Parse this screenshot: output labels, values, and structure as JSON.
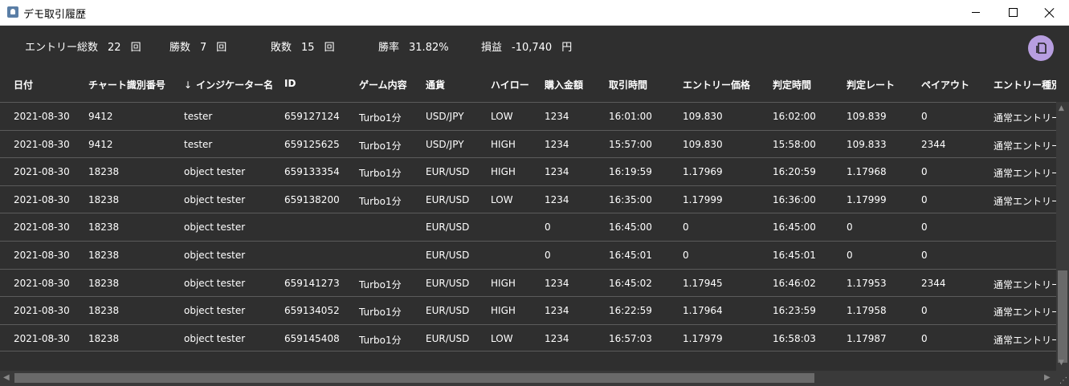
{
  "window": {
    "title": "デモ取引履歴"
  },
  "stats": {
    "entries": {
      "label": "エントリー総数",
      "value": "22",
      "unit": "回"
    },
    "wins": {
      "label": "勝数",
      "value": "7",
      "unit": "回"
    },
    "losses": {
      "label": "敗数",
      "value": "15",
      "unit": "回"
    },
    "winrate": {
      "label": "勝率",
      "value": "31.82%"
    },
    "pnl": {
      "label": "損益",
      "value": "-10,740",
      "unit": "円"
    }
  },
  "columns": [
    "日付",
    "チャート識別番号",
    "インジケーター名",
    "ID",
    "ゲーム内容",
    "通貨",
    "ハイロー",
    "購入金額",
    "取引時間",
    "エントリー価格",
    "判定時間",
    "判定レート",
    "ペイアウト",
    "エントリー種別"
  ],
  "sorted_column": "インジケーター名",
  "sort_direction": "descending",
  "rows": [
    [
      "2021-08-30",
      "9412",
      "tester",
      "659127124",
      "Turbo1分",
      "USD/JPY",
      "LOW",
      "1234",
      "16:01:00",
      "109.830",
      "16:02:00",
      "109.839",
      "0",
      "通常エントリー"
    ],
    [
      "2021-08-30",
      "9412",
      "tester",
      "659125625",
      "Turbo1分",
      "USD/JPY",
      "HIGH",
      "1234",
      "15:57:00",
      "109.830",
      "15:58:00",
      "109.833",
      "2344",
      "通常エントリー"
    ],
    [
      "2021-08-30",
      "18238",
      "object tester",
      "659133354",
      "Turbo1分",
      "EUR/USD",
      "HIGH",
      "1234",
      "16:19:59",
      "1.17969",
      "16:20:59",
      "1.17968",
      "0",
      "通常エントリー"
    ],
    [
      "2021-08-30",
      "18238",
      "object tester",
      "659138200",
      "Turbo1分",
      "EUR/USD",
      "LOW",
      "1234",
      "16:35:00",
      "1.17999",
      "16:36:00",
      "1.17999",
      "0",
      "通常エントリー"
    ],
    [
      "2021-08-30",
      "18238",
      "object tester",
      "",
      "",
      "EUR/USD",
      "",
      "0",
      "16:45:00",
      "0",
      "16:45:00",
      "0",
      "0",
      ""
    ],
    [
      "2021-08-30",
      "18238",
      "object tester",
      "",
      "",
      "EUR/USD",
      "",
      "0",
      "16:45:01",
      "0",
      "16:45:01",
      "0",
      "0",
      ""
    ],
    [
      "2021-08-30",
      "18238",
      "object tester",
      "659141273",
      "Turbo1分",
      "EUR/USD",
      "HIGH",
      "1234",
      "16:45:02",
      "1.17945",
      "16:46:02",
      "1.17953",
      "2344",
      "通常エントリー"
    ],
    [
      "2021-08-30",
      "18238",
      "object tester",
      "659134052",
      "Turbo1分",
      "EUR/USD",
      "HIGH",
      "1234",
      "16:22:59",
      "1.17964",
      "16:23:59",
      "1.17958",
      "0",
      "通常エントリー"
    ],
    [
      "2021-08-30",
      "18238",
      "object tester",
      "659145408",
      "Turbo1分",
      "EUR/USD",
      "LOW",
      "1234",
      "16:57:03",
      "1.17979",
      "16:58:03",
      "1.17987",
      "0",
      "通常エントリー"
    ]
  ],
  "icons": {
    "app": "app-icon",
    "copy": "copy-icon",
    "sort": "arrow-down-icon"
  },
  "colors": {
    "background": "#2f2f2f",
    "accent_button": "#b79ee0",
    "row_divider": "#5b5b5b"
  }
}
